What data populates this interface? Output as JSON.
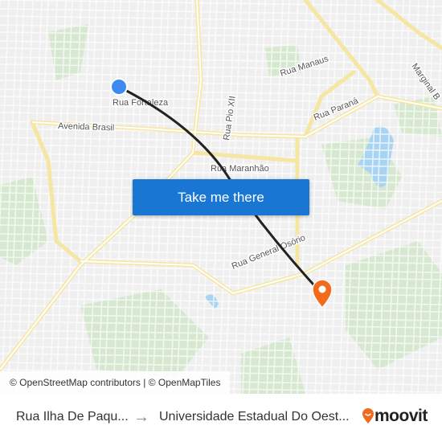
{
  "map": {
    "street_labels": [
      "Rua Fortaleza",
      "Avenida Brasil",
      "Rua Pio XII",
      "Rua Manaus",
      "Rua Paraná",
      "Marginal B",
      "Rua Maranhão",
      "Rua General Osório"
    ],
    "origin_marker_color": "#3d8bf2",
    "destination_marker_color": "#f26b1d",
    "route_color": "#222222",
    "attribution": "© OpenStreetMap contributors | © OpenMapTiles"
  },
  "cta": {
    "label": "Take me there",
    "color": "#1976d2"
  },
  "footer": {
    "from": "Rua Ilha De Paqu...",
    "to": "Universidade Estadual Do Oest...",
    "brand": "moovit",
    "brand_color": "#f26b1d"
  }
}
